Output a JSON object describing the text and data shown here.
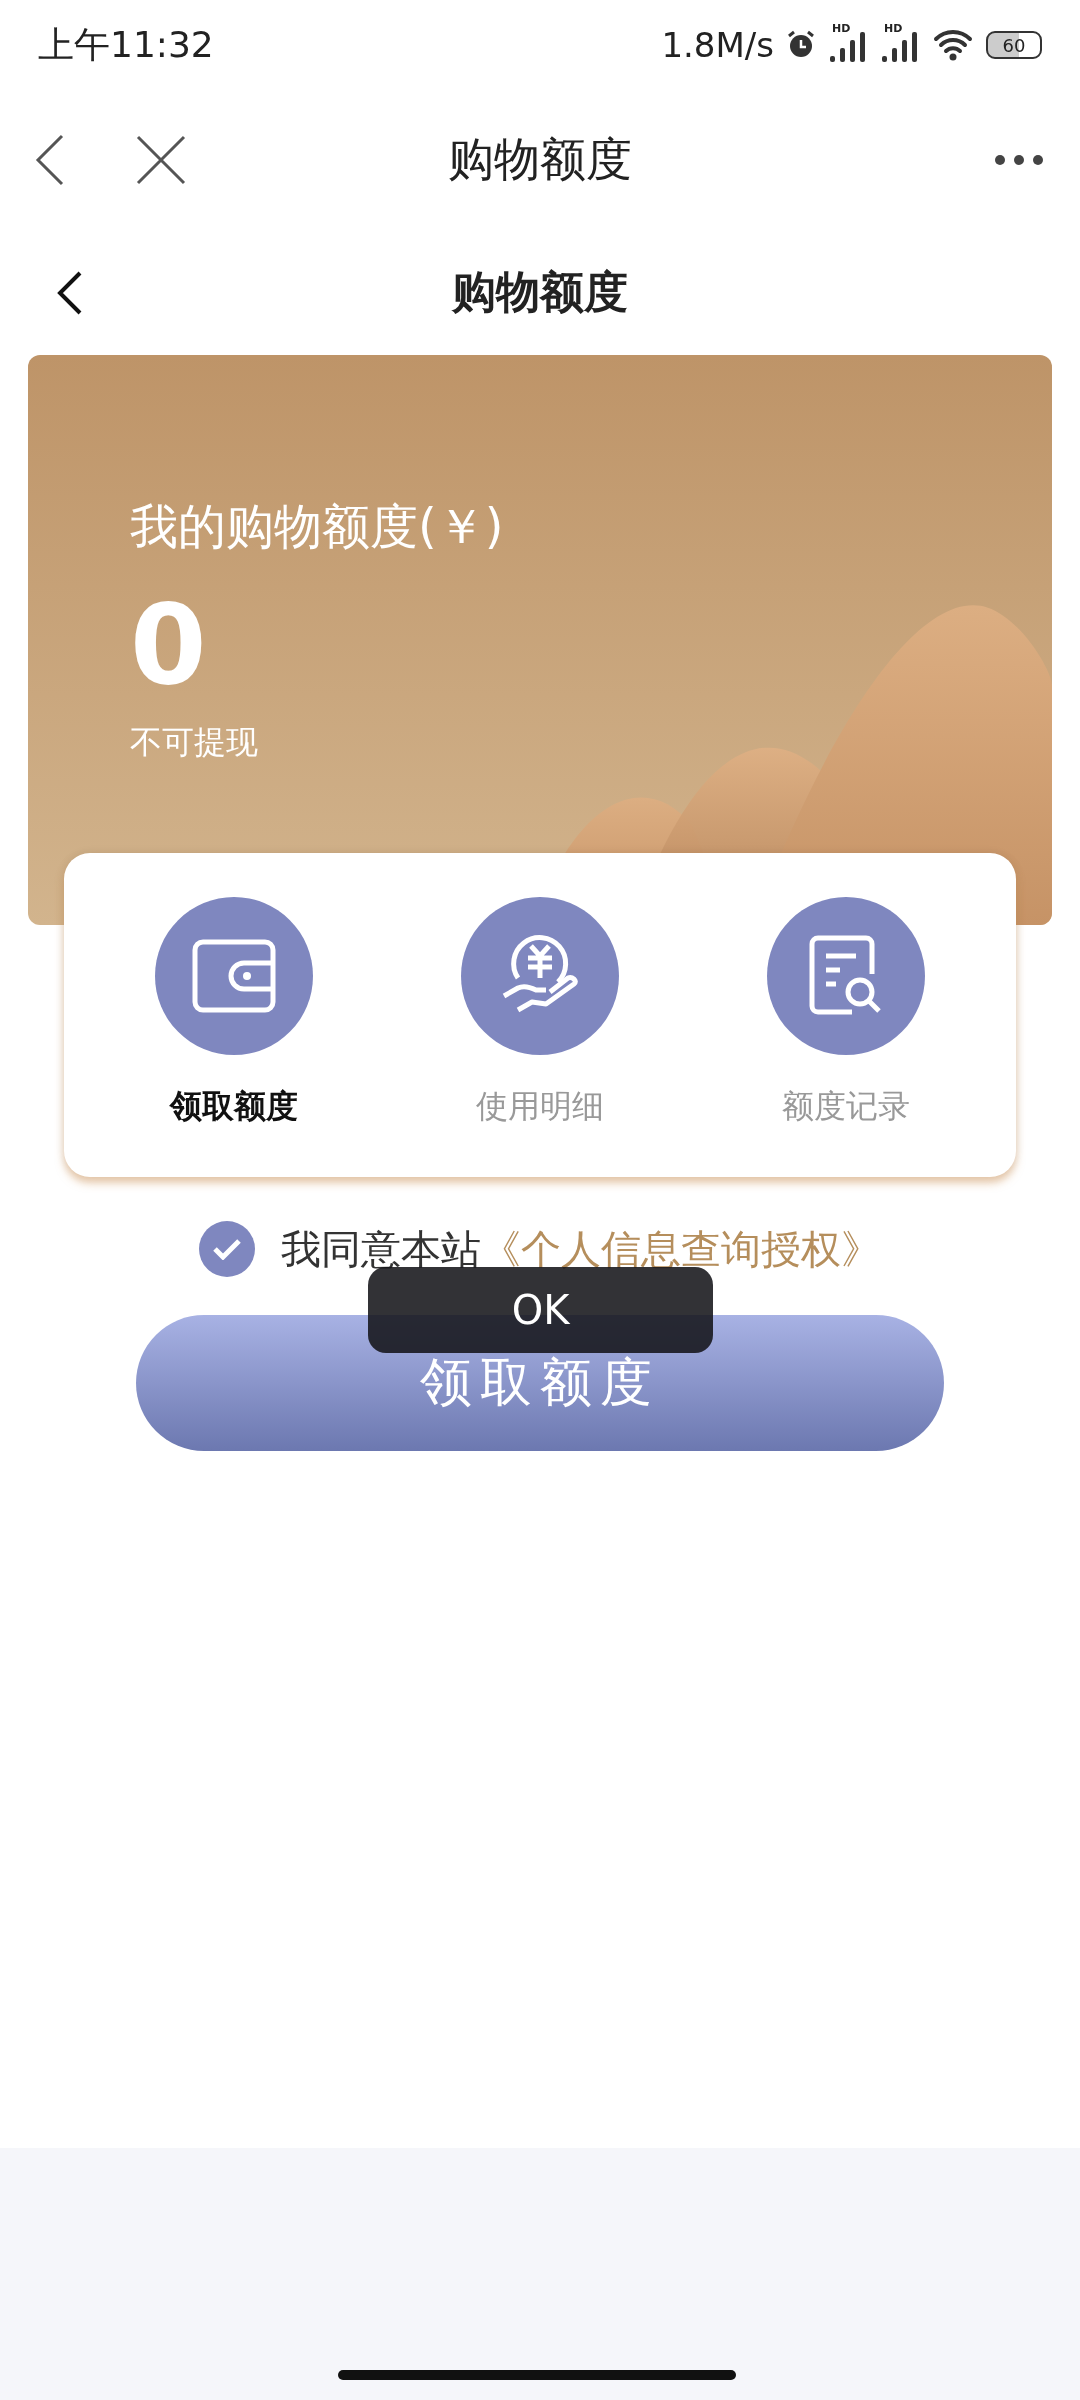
{
  "status_bar": {
    "time": "上午11:32",
    "speed": "1.8M/s",
    "signals": [
      {
        "badge": "HD"
      },
      {
        "badge": "HD"
      }
    ],
    "battery": "60"
  },
  "browser_bar": {
    "title": "购物额度"
  },
  "header": {
    "title": "购物额度"
  },
  "quota_card": {
    "label": "我的购物额度(￥)",
    "amount": "0",
    "note": "不可提现"
  },
  "actions": [
    {
      "kind": "wallet",
      "label": "领取额度",
      "selected": true
    },
    {
      "kind": "coin",
      "label": "使用明细",
      "selected": false
    },
    {
      "kind": "record",
      "label": "额度记录",
      "selected": false
    }
  ],
  "agreement": {
    "checked": true,
    "text": "我同意本站",
    "link": "《个人信息查询授权》"
  },
  "primary_button": "领取额度",
  "toast": "OK"
}
